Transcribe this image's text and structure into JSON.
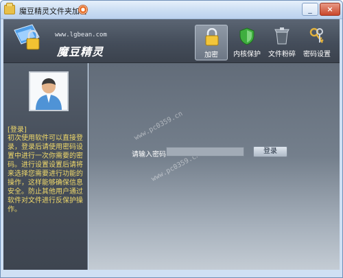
{
  "window": {
    "title": "魔豆精灵文件夹加密",
    "minimize_glyph": "_",
    "close_glyph": "×"
  },
  "brand": {
    "url": "www.lgbean.com",
    "name": "魔豆精灵"
  },
  "toolbar": {
    "items": [
      {
        "label": "加密",
        "icon": "lock-icon",
        "active": true
      },
      {
        "label": "内核保护",
        "icon": "shield-icon",
        "active": false
      },
      {
        "label": "文件粉碎",
        "icon": "shredder-icon",
        "active": false
      },
      {
        "label": "密码设置",
        "icon": "key-icon",
        "active": false
      }
    ]
  },
  "sidebar": {
    "heading": "[登录]",
    "help_text": "初次使用软件可以直接登录，登录后请使用密码设置中进行一次你需要的密码。进行设置设置后请将来选择您需要进行功能的操作，这样能够确保信息安全。防止其他用户通过软件对文件进行反保护操作。"
  },
  "login": {
    "label": "请输入密码：",
    "password_value": "",
    "button_label": "登录"
  },
  "watermarks": [
    "www.pc0359.cn",
    "www.pc0359.cn"
  ],
  "colors": {
    "accent_yellow": "#f0d96a",
    "header_dark": "#444d5a",
    "window_frame": "#cfe0f4"
  }
}
